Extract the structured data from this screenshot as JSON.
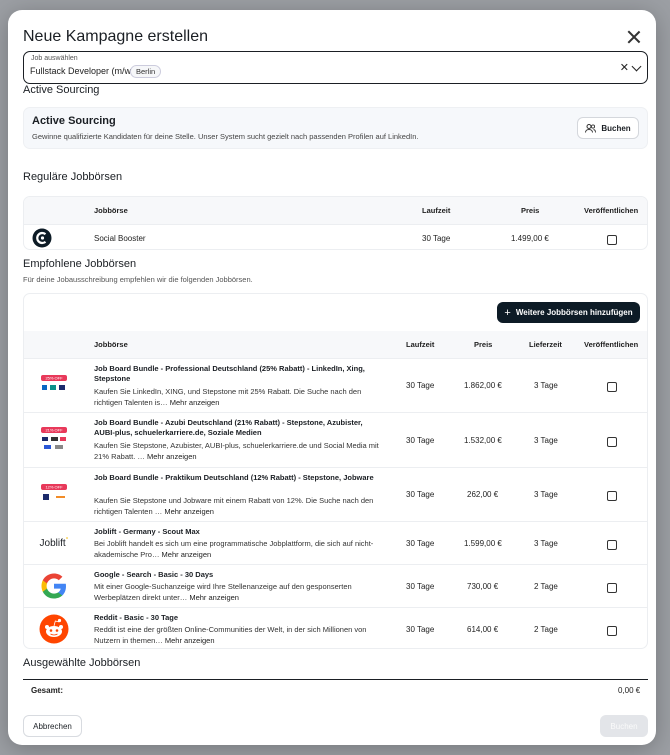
{
  "modal": {
    "title": "Neue Kampagne erstellen"
  },
  "job_select": {
    "label": "Job auswählen",
    "value": "Fullstack Developer (m/w/d)",
    "location": "Berlin"
  },
  "active_sourcing": {
    "section_title": "Active Sourcing",
    "card_title": "Active Sourcing",
    "description": "Gewinne qualifizierte Kandidaten für deine Stelle. Unser System sucht gezielt nach passenden Profilen auf LinkedIn.",
    "button": "Buchen"
  },
  "regular": {
    "title": "Reguläre Jobbörsen",
    "headers": {
      "board": "Jobbörse",
      "duration": "Laufzeit",
      "price": "Preis",
      "published": "Veröffentlichen"
    },
    "rows": [
      {
        "name": "Social Booster",
        "duration": "30 Tage",
        "price": "1.499,00 €"
      }
    ]
  },
  "recommended": {
    "title": "Empfohlene Jobbörsen",
    "subtitle": "Für deine Jobausschreibung empfehlen wir die folgenden Jobbörsen.",
    "add_button": "Weitere Jobbörsen hinzufügen",
    "headers": {
      "board": "Jobbörse",
      "duration": "Laufzeit",
      "price": "Preis",
      "delivery": "Lieferzeit",
      "published": "Veröffentlichen"
    },
    "more_label": "Mehr anzeigen",
    "rows": [
      {
        "name": "Job Board Bundle - Professional Deutschland (25% Rabatt) - LinkedIn, Xing, Stepstone",
        "desc": "Kaufen Sie LinkedIn, XING, und Stepstone mit 25% Rabatt. Die Suche nach den richtigen Talenten is…",
        "duration": "30 Tage",
        "price": "1.862,00 €",
        "delivery": "3 Tage",
        "badge": "25% OFF"
      },
      {
        "name": "Job Board Bundle - Azubi Deutschland (21% Rabatt) - Stepstone, Azubister, AUBI-plus, schuelerkarriere.de, Soziale Medien",
        "desc": "Kaufen Sie Stepstone, Azubister, AUBI-plus, schuelerkarriere.de und Social Media mit 21% Rabatt. …",
        "duration": "30 Tage",
        "price": "1.532,00 €",
        "delivery": "3 Tage",
        "badge": "21% OFF"
      },
      {
        "name": "Job Board Bundle - Praktikum Deutschland (12% Rabatt) - Stepstone, Jobware",
        "desc": "Kaufen Sie Stepstone und Jobware mit einem Rabatt von 12%. Die Suche nach den richtigen Talenten …",
        "duration": "30 Tage",
        "price": "262,00 €",
        "delivery": "3 Tage",
        "badge": "12% OFF"
      },
      {
        "name": "Joblift - Germany - Scout Max",
        "desc": "Bei Joblift handelt es sich um eine programmatische Jobplattform, die sich auf nicht-akademische Pro…",
        "duration": "30 Tage",
        "price": "1.599,00 €",
        "delivery": "3 Tage",
        "logo_text": "Joblift"
      },
      {
        "name": "Google - Search - Basic - 30 Days",
        "desc": "Mit einer Google-Suchanzeige wird Ihre Stellenanzeige auf den gesponserten Werbeplätzen direkt unter…",
        "duration": "30 Tage",
        "price": "730,00 €",
        "delivery": "2 Tage"
      },
      {
        "name": "Reddit - Basic - 30 Tage",
        "desc": "Reddit ist eine der größten Online-Communities der Welt, in der sich Millionen von Nutzern in themen…",
        "duration": "30 Tage",
        "price": "614,00 €",
        "delivery": "2 Tage"
      }
    ]
  },
  "selected": {
    "title": "Ausgewählte Jobbörsen",
    "total_label": "Gesamt:",
    "total_value": "0,00 €"
  },
  "footer": {
    "cancel": "Abbrechen",
    "submit": "Buchen"
  },
  "colors": {
    "primary": "#0d1b26",
    "badge": "#e8395a",
    "google_blue": "#4285f4",
    "reddit": "#ff4500"
  }
}
